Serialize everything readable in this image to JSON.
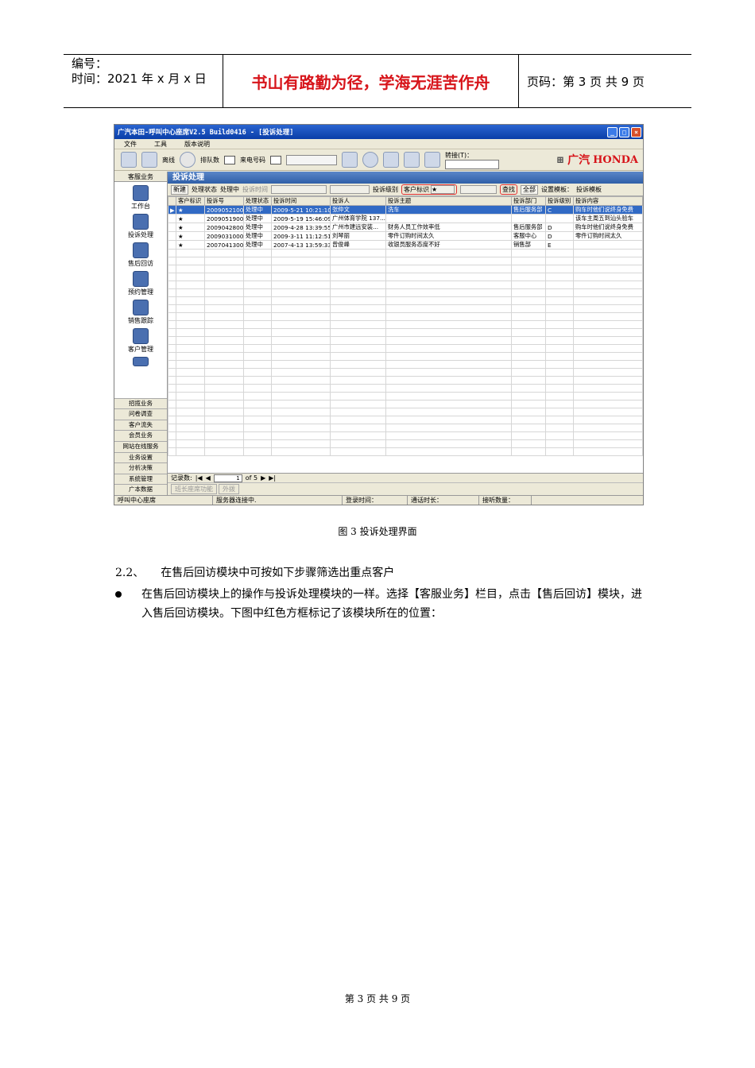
{
  "header": {
    "number_label": "编号：",
    "time_label": "时间：2021 年 x 月 x 日",
    "motto": "书山有路勤为径，学海无涯苦作舟",
    "page_label": "页码：第 3 页  共 9 页"
  },
  "app": {
    "title": "广汽本田-呼叫中心座席V2.5 Build0416 - [投诉处理]",
    "menu": [
      "文件",
      "工具",
      "版本说明"
    ],
    "toolbar": {
      "offline": "离线",
      "queue": "排队数",
      "caller": "来电号码",
      "transfer": "转接(T)：",
      "brand_gq": "广汽",
      "brand_honda": "HONDA"
    },
    "sidebar": {
      "head": "客服业务",
      "items": [
        "工作台",
        "投诉处理",
        "售后回访",
        "预约管理",
        "销售跟踪",
        "客户管理"
      ],
      "nav": [
        "招揽业务",
        "问卷调查",
        "客户流失",
        "会员业务",
        "网站在线服务",
        "业务设置",
        "分析决策",
        "系统管理",
        "广本数据"
      ]
    },
    "pane_title": "投诉处理",
    "filter": {
      "new": "新建",
      "status_label": "处理状态",
      "status_value": "处理中",
      "time_label": "投诉时间",
      "level_label": "投诉级别",
      "customer_mark": "客户标识",
      "customer_mark_value": "★",
      "search": "查找",
      "all": "全部",
      "template": "设置模板：",
      "template_value": "投诉模板"
    },
    "columns": [
      "客户标识",
      "投诉号",
      "处理状态",
      "投诉时间",
      "投诉人",
      "投诉主题",
      "投诉部门",
      "投诉级别",
      "投诉内容"
    ],
    "rows": [
      [
        "★",
        "20090521001",
        "处理中",
        "2009-5-21 10:21:10",
        "张仲文",
        "洗车",
        "售后服务部",
        "C",
        "购车时他们说终身免费"
      ],
      [
        "★",
        "20090519001",
        "处理中",
        "2009-5-19 15:46:09",
        "广州体育学院 137...",
        "",
        "",
        "",
        "该车主周五到汕头验车"
      ],
      [
        "★",
        "20090428001",
        "处理中",
        "2009-4-28 13:39:55",
        "广州市建远安装...",
        "财务人员工作效率低",
        "售后服务部",
        "D",
        "购车时他们说终身免费"
      ],
      [
        "★",
        "20090310001",
        "处理中",
        "2009-3-11 11:12:51",
        "刘琴丽",
        "零件订购时间太久",
        "客服中心",
        "D",
        "零件订购时间太久"
      ],
      [
        "★",
        "20070413001",
        "处理中",
        "2007-4-13 13:59:33",
        "曾俊峰",
        "收银员服务态度不好",
        "销售部",
        "E",
        ""
      ]
    ],
    "pager": {
      "records": "记录数:",
      "page": "1",
      "of": "of 5"
    },
    "bottom_tools": [
      "班长座席功能",
      "外拨"
    ],
    "status": [
      "呼叫中心座席",
      "服务器连接中.",
      "登录时间：",
      "通话时长：",
      "接听数量："
    ]
  },
  "caption": "图 3 投诉处理界面",
  "section": "2.2、　　在售后回访模块中可按如下步骤筛选出重点客户",
  "bullet": "在售后回访模块上的操作与投诉处理模块的一样。选择【客服业务】栏目，点击【售后回访】模块，进入售后回访模块。下图中红色方框标记了该模块所在的位置：",
  "footer": "第 3 页 共 9 页"
}
